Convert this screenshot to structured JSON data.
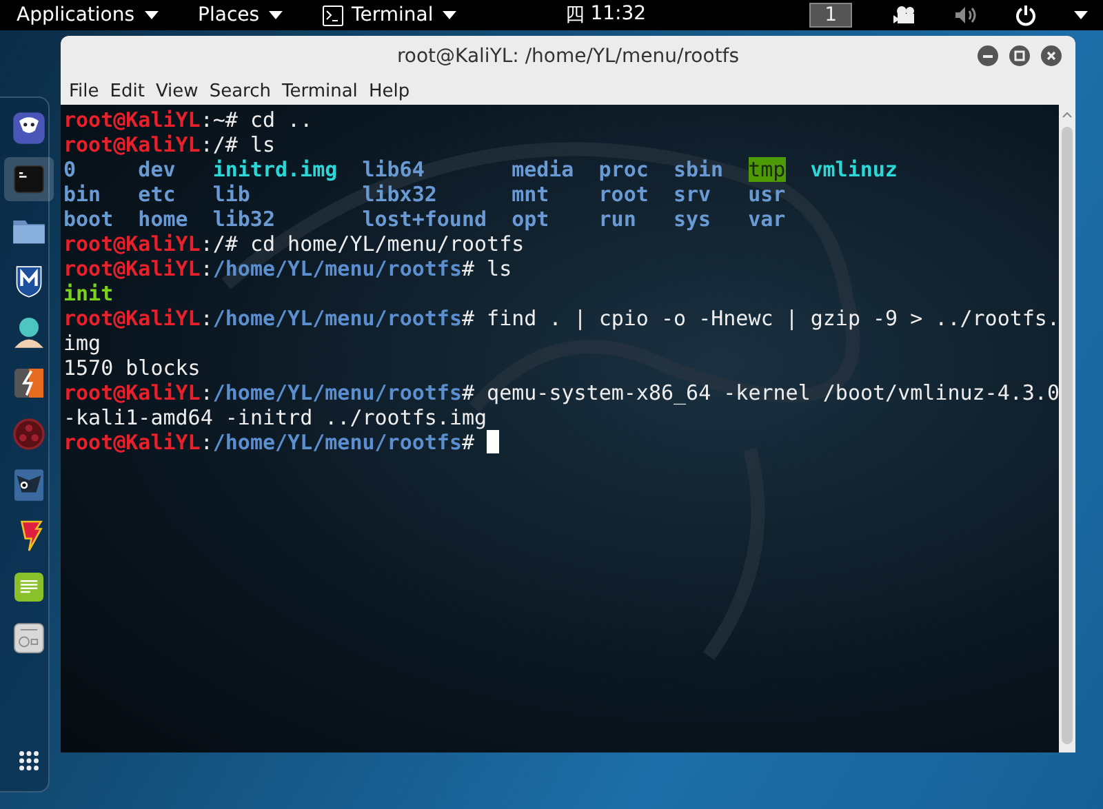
{
  "top_bar": {
    "menus": [
      {
        "label": "Applications",
        "icon": false
      },
      {
        "label": "Places",
        "icon": false
      },
      {
        "label": "Terminal",
        "icon": true
      }
    ],
    "input_method": "四",
    "clock": "11:32",
    "workspace": "1"
  },
  "dock": {
    "items": [
      {
        "kind": "dragon",
        "selected": false
      },
      {
        "kind": "terminal",
        "selected": true
      },
      {
        "kind": "folder",
        "selected": false
      },
      {
        "kind": "shield",
        "selected": false
      },
      {
        "kind": "avatar",
        "selected": false
      },
      {
        "kind": "burp",
        "selected": false
      },
      {
        "kind": "armitage",
        "selected": false
      },
      {
        "kind": "face",
        "selected": false
      },
      {
        "kind": "flash",
        "selected": false
      },
      {
        "kind": "notes",
        "selected": false
      },
      {
        "kind": "radio",
        "selected": false
      },
      {
        "kind": "grid",
        "selected": false
      }
    ]
  },
  "window": {
    "title": "root@KaliYL: /home/YL/menu/rootfs",
    "menu": [
      "File",
      "Edit",
      "View",
      "Search",
      "Terminal",
      "Help"
    ]
  },
  "terminal": {
    "lines": [
      {
        "kind": "text",
        "segments": [
          {
            "kind": "user",
            "text": "root@KaliYL"
          },
          {
            "kind": "plain",
            "text": ":~# cd .."
          }
        ]
      },
      {
        "kind": "text",
        "segments": [
          {
            "kind": "user",
            "text": "root@KaliYL"
          },
          {
            "kind": "plain",
            "text": ":/# ls"
          }
        ]
      },
      {
        "kind": "listing",
        "rows": [
          [
            {
              "kind": "dir",
              "text": "0"
            },
            {
              "kind": "dir",
              "text": "dev"
            },
            {
              "kind": "exec",
              "text": "initrd.img"
            },
            {
              "kind": "dir",
              "text": "lib64"
            },
            {
              "kind": "dir",
              "text": "media"
            },
            {
              "kind": "dir",
              "text": "proc"
            },
            {
              "kind": "dir",
              "text": "sbin"
            },
            {
              "kind": "sticky",
              "text": "tmp"
            },
            {
              "kind": "exec",
              "text": "vmlinuz"
            }
          ],
          [
            {
              "kind": "dir",
              "text": "bin"
            },
            {
              "kind": "dir",
              "text": "etc"
            },
            {
              "kind": "dir",
              "text": "lib"
            },
            {
              "kind": "dir",
              "text": "libx32"
            },
            {
              "kind": "dir",
              "text": "mnt"
            },
            {
              "kind": "dir",
              "text": "root"
            },
            {
              "kind": "dir",
              "text": "srv"
            },
            {
              "kind": "dir",
              "text": "usr"
            }
          ],
          [
            {
              "kind": "dir",
              "text": "boot"
            },
            {
              "kind": "dir",
              "text": "home"
            },
            {
              "kind": "dir",
              "text": "lib32"
            },
            {
              "kind": "dir",
              "text": "lost+found"
            },
            {
              "kind": "dir",
              "text": "opt"
            },
            {
              "kind": "dir",
              "text": "run"
            },
            {
              "kind": "dir",
              "text": "sys"
            },
            {
              "kind": "dir",
              "text": "var"
            }
          ]
        ]
      },
      {
        "kind": "text",
        "segments": [
          {
            "kind": "user",
            "text": "root@KaliYL"
          },
          {
            "kind": "plain",
            "text": ":/# cd home/YL/menu/rootfs"
          }
        ]
      },
      {
        "kind": "text",
        "segments": [
          {
            "kind": "user",
            "text": "root@KaliYL"
          },
          {
            "kind": "plain",
            "text": ":"
          },
          {
            "kind": "path",
            "text": "/home/YL/menu/rootfs"
          },
          {
            "kind": "plain",
            "text": "# ls"
          }
        ]
      },
      {
        "kind": "text",
        "segments": [
          {
            "kind": "file",
            "text": "init"
          }
        ]
      },
      {
        "kind": "text",
        "segments": [
          {
            "kind": "user",
            "text": "root@KaliYL"
          },
          {
            "kind": "plain",
            "text": ":"
          },
          {
            "kind": "path",
            "text": "/home/YL/menu/rootfs"
          },
          {
            "kind": "plain",
            "text": "# find . | cpio -o -Hnewc | gzip -9 > ../rootfs."
          }
        ]
      },
      {
        "kind": "text",
        "segments": [
          {
            "kind": "plain",
            "text": "img"
          }
        ]
      },
      {
        "kind": "text",
        "segments": [
          {
            "kind": "plain",
            "text": "1570 blocks"
          }
        ]
      },
      {
        "kind": "text",
        "segments": [
          {
            "kind": "user",
            "text": "root@KaliYL"
          },
          {
            "kind": "plain",
            "text": ":"
          },
          {
            "kind": "path",
            "text": "/home/YL/menu/rootfs"
          },
          {
            "kind": "plain",
            "text": "# qemu-system-x86_64 -kernel /boot/vmlinuz-4.3.0"
          }
        ]
      },
      {
        "kind": "text",
        "segments": [
          {
            "kind": "plain",
            "text": "-kali1-amd64 -initrd ../rootfs.img"
          }
        ]
      },
      {
        "kind": "text",
        "cursor": true,
        "segments": [
          {
            "kind": "user",
            "text": "root@KaliYL"
          },
          {
            "kind": "plain",
            "text": ":"
          },
          {
            "kind": "path",
            "text": "/home/YL/menu/rootfs"
          },
          {
            "kind": "plain",
            "text": "# "
          }
        ]
      }
    ]
  }
}
